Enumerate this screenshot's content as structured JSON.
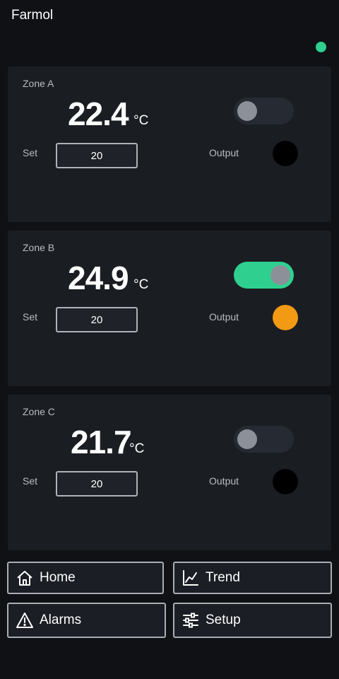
{
  "app": {
    "title": "Farmol"
  },
  "status": {
    "connection_color": "#2fd08f"
  },
  "zones": [
    {
      "name": "Zone A",
      "temp": "22.4",
      "unit": "°C",
      "heater_on": false,
      "set_label": "Set",
      "setpoint": "20",
      "output_label": "Output",
      "output_color": "#000000"
    },
    {
      "name": "Zone B",
      "temp": "24.9",
      "unit": "°C",
      "heater_on": true,
      "set_label": "Set",
      "setpoint": "20",
      "output_label": "Output",
      "output_color": "#f39a14"
    },
    {
      "name": "Zone C",
      "temp": "21.7",
      "unit": "°C",
      "heater_on": false,
      "set_label": "Set",
      "setpoint": "20",
      "output_label": "Output",
      "output_color": "#000000"
    }
  ],
  "nav": {
    "home": {
      "label": "Home",
      "icon": "home-icon"
    },
    "trend": {
      "label": "Trend",
      "icon": "trend-icon"
    },
    "alarms": {
      "label": "Alarms",
      "icon": "warning-icon"
    },
    "setup": {
      "label": "Setup",
      "icon": "sliders-icon"
    }
  },
  "colors": {
    "accent": "#2fd08f",
    "output_active": "#f39a14",
    "card_bg": "#1a1d22"
  }
}
